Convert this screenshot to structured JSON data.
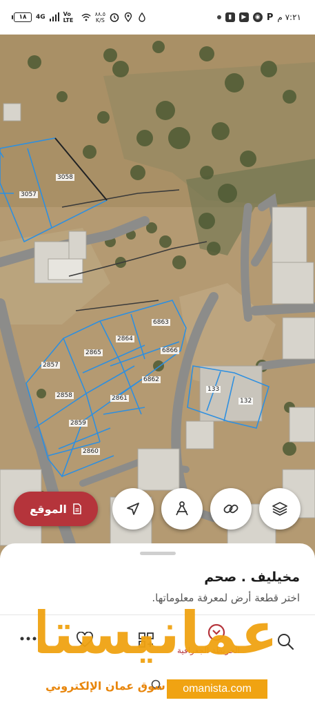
{
  "status_bar": {
    "time": "٧:٢١ م",
    "battery": "١٨",
    "network": "4G",
    "volte": "Vo LTE",
    "speed_value": "٨٨.٥",
    "speed_unit": "K/S"
  },
  "map": {
    "plots": [
      "3058",
      "3057",
      "6863",
      "2864",
      "6866",
      "2865",
      "2857",
      "6862",
      "2861",
      "2858",
      "2859",
      "2860",
      "133",
      "132"
    ],
    "colors": {
      "plot_outline": "#2d8fe0",
      "road": "#8a8a8a",
      "brand_red": "#b5343b"
    }
  },
  "actions": {
    "location_label": "الموقع",
    "buttons": [
      "layers-icon",
      "link-icon",
      "measure-icon",
      "navigate-icon"
    ]
  },
  "sheet": {
    "title": "مخيليف . صحم",
    "hint": "اختر قطعة أرض لمعرفة معلوماتها.",
    "nav": {
      "map_label": "الخريطة الجغرافية"
    }
  },
  "watermark": {
    "word": "عمانيستا",
    "domain": "omanista.com",
    "tagline": "سوق عمان الإلكتروني",
    "colors": {
      "primary": "#f0a312"
    }
  }
}
